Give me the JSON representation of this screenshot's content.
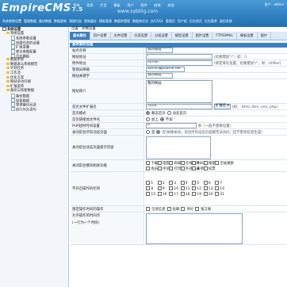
{
  "header": {
    "logo": "EmpireCMS",
    "logo_sub": "7.5",
    "watermark": "www.xybl0g.com",
    "user_text": "用户：admin",
    "main_nav": [
      "系统",
      "信息",
      "栏目",
      "模板",
      "用户",
      "插件",
      "商城",
      "其他"
    ],
    "sub_nav": [
      "系统参数设置",
      "管理数据",
      "备份数据",
      "数据更新",
      "清理垃圾",
      "更新缓存",
      "模板管理",
      "数据库管理",
      "数据库优化",
      "执行SQL",
      "管理员",
      "用户组",
      "后台首页",
      "后台菜单",
      "退出系统"
    ]
  },
  "sidebar": {
    "items": [
      {
        "level": 0,
        "icon": "box",
        "label": "系统设置"
      },
      {
        "level": 1,
        "icon": "folder",
        "label": "系统设置"
      },
      {
        "level": 2,
        "icon": "doc",
        "label": "系统参数设置"
      },
      {
        "level": 2,
        "icon": "doc",
        "label": "创建任务的设置"
      },
      {
        "level": 2,
        "icon": "doc",
        "label": "扩展变量"
      },
      {
        "level": 2,
        "icon": "doc",
        "label": "安全参数配置"
      },
      {
        "level": 2,
        "icon": "doc",
        "label": "日志模板"
      },
      {
        "level": 1,
        "icon": "folder",
        "label": "数据更新"
      },
      {
        "level": 1,
        "icon": "folder",
        "label": "数据表与系统模型"
      },
      {
        "level": 1,
        "icon": "folder",
        "label": "计划任务"
      },
      {
        "level": 1,
        "icon": "folder",
        "label": "工作流"
      },
      {
        "level": 1,
        "icon": "folder",
        "label": "优化方案"
      },
      {
        "level": 1,
        "icon": "folder",
        "label": "网站多访问端"
      },
      {
        "level": 1,
        "icon": "folder",
        "label": "扩展菜单"
      },
      {
        "level": 1,
        "icon": "folder",
        "label": "备份与恢复数据"
      },
      {
        "level": 2,
        "icon": "doc",
        "label": "备份数据"
      },
      {
        "level": 2,
        "icon": "doc",
        "label": "恢复数据"
      },
      {
        "level": 2,
        "icon": "doc",
        "label": "管理备份目录"
      },
      {
        "level": 2,
        "icon": "doc",
        "label": "执行SQL语句"
      }
    ]
  },
  "main": {
    "breadcrumb": "位置：参数设置",
    "tabs": [
      "基本属性",
      "用户设置",
      "文件设置",
      "方案设置",
      "分组设置",
      "模型设置",
      "图片设置",
      "FTP/EMAIL",
      "模板设置",
      "图片"
    ],
    "section_title": "基本属性设置",
    "fields": {
      "site_name_label": "站点名称",
      "site_name_value": "我的网站",
      "site_url_label": "网站地址",
      "site_url_value": "/",
      "site_url_hint": "(结尾需加\"/\"，如：/)",
      "attach_url_label": "附件地址",
      "attach_url_value": "/d/file/",
      "attach_url_hint": "(绑定域名设置，结尾需加\"/\"，如：/d/file/)",
      "email_label": "管理员邮箱",
      "email_value": "admin@phome.net",
      "keywords_label": "网站关键字",
      "keywords_value": "我的网站",
      "desc_label": "网站简介",
      "desc_value": "我的网站",
      "index_ext_label": "首页文件扩展名",
      "index_ext_value": ".html",
      "index_ext_select": "扩展名",
      "index_ext_hint": "(如：.html,.htm,.xml,.php)",
      "index_mode_label": "首页模式",
      "index_mode_opt1": "静态首页",
      "index_mode_opt2": "动态首页",
      "index_listfile_label": "首页链接加文件名",
      "index_listfile_opt1": "加上",
      "index_listfile_opt2": "不加",
      "php_timeout_label": "PHP超时时间设置",
      "php_timeout_value": "0",
      "php_timeout_hint": "秒（一般不需要设置）",
      "close_site_label": "关闭前台所有动态页面",
      "close_site_opt1": "是",
      "close_site_opt2": "否(如果关闭，前台所有动态页面都无法访问，但不影响信息生成)",
      "close_reason_label": "关闭前台动态页面提示内容",
      "close_modules_label": "关闭前台模块相关功能",
      "close_modules": [
        "下载",
        "电影",
        "商城",
        "在线支付",
        "RSS",
        "搜索",
        "全站搜索",
        "会员",
        "评论",
        "打印",
        "外部登录",
        "表单",
        "投票"
      ],
      "close_classes_label": "不开启操作的栏目",
      "close_classes": [
        "1",
        "2",
        "3",
        "4",
        "5",
        "6",
        "7",
        "8",
        "9",
        "10",
        "11",
        "12",
        "13",
        "14",
        "15",
        "16",
        "17",
        "18",
        "19",
        "20",
        "21"
      ],
      "pre_time_label": "限定操作时间的操作",
      "pre_time_opts": [
        "全部信息",
        "投稿",
        "评论",
        "留言板"
      ],
      "pre_time_detail_label": "允许操作的时间点",
      "pre_time_detail_sub": "(一行为一个时间)"
    }
  }
}
